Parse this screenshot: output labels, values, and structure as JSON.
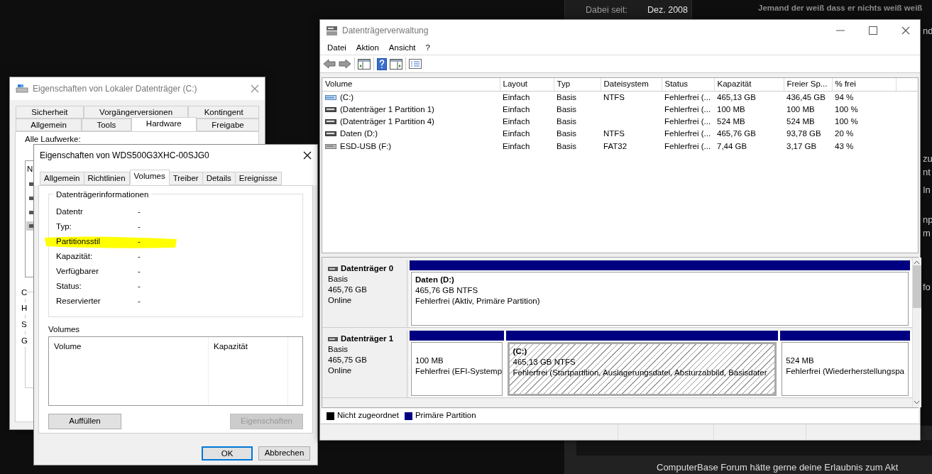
{
  "forum_background": {
    "member_since_label": "Dabei seit:",
    "member_since_value": "Dez. 2008",
    "signature": "Jemand der weiß dass er nichts weiß weiß",
    "side_fragments": [
      "nd",
      "zu",
      "nt",
      "In",
      "np",
      "m",
      "fo"
    ],
    "consent_banner": "ComputerBase Forum hätte gerne deine Erlaubnis zum Akt"
  },
  "disk_management": {
    "title": "Datenträgerverwaltung",
    "menu": [
      "Datei",
      "Aktion",
      "Ansicht",
      "?"
    ],
    "table": {
      "columns": [
        "Volume",
        "Layout",
        "Typ",
        "Dateisystem",
        "Status",
        "Kapazität",
        "Freier Sp...",
        "% frei"
      ],
      "rows": [
        {
          "kind": "system",
          "cells": [
            "(C:)",
            "Einfach",
            "Basis",
            "NTFS",
            "Fehlerfrei (...",
            "465,13 GB",
            "436,45 GB",
            "94 %"
          ]
        },
        {
          "kind": "partition",
          "cells": [
            "(Datenträger 1 Partition 1)",
            "Einfach",
            "Basis",
            "",
            "Fehlerfrei (...",
            "100 MB",
            "100 MB",
            "100 %"
          ]
        },
        {
          "kind": "partition",
          "cells": [
            "(Datenträger 1 Partition 4)",
            "Einfach",
            "Basis",
            "",
            "Fehlerfrei (...",
            "524 MB",
            "524 MB",
            "100 %"
          ]
        },
        {
          "kind": "partition",
          "cells": [
            "Daten (D:)",
            "Einfach",
            "Basis",
            "NTFS",
            "Fehlerfrei (...",
            "465,76 GB",
            "93,78 GB",
            "20 %"
          ]
        },
        {
          "kind": "usb",
          "cells": [
            "ESD-USB (F:)",
            "Einfach",
            "Basis",
            "FAT32",
            "Fehlerfrei (...",
            "7,44 GB",
            "3,17 GB",
            "43 %"
          ]
        }
      ]
    },
    "disks": [
      {
        "name": "Datenträger 0",
        "type": "Basis",
        "size": "465,76 GB",
        "status": "Online",
        "partitions": [
          {
            "title": "Daten  (D:)",
            "size": "465,76 GB NTFS",
            "status": "Fehlerfrei (Aktiv, Primäre Partition)",
            "selected": false
          }
        ]
      },
      {
        "name": "Datenträger 1",
        "type": "Basis",
        "size": "465,75 GB",
        "status": "Online",
        "partitions": [
          {
            "size": "100 MB",
            "status": "Fehlerfrei (EFI-Systemp",
            "selected": false
          },
          {
            "title": "(C:)",
            "size": "465,13 GB NTFS",
            "status": "Fehlerfrei (Startpartition, Auslagerungsdatei, Absturzabbild, Basisdater",
            "selected": true
          },
          {
            "size": "524 MB",
            "status": "Fehlerfrei (Wiederherstellungspa",
            "selected": false
          }
        ]
      }
    ],
    "legend": [
      {
        "label": "Nicht zugeordnet",
        "color": "#000000"
      },
      {
        "label": "Primäre Partition",
        "color": "#000080"
      }
    ]
  },
  "drive_properties": {
    "title": "Eigenschaften von Lokaler Datenträger (C:)",
    "tab_rows": [
      [
        {
          "label": "Sicherheit",
          "selected": false
        },
        {
          "label": "Vorgängerversionen",
          "selected": false
        },
        {
          "label": "Kontingent",
          "selected": false
        }
      ],
      [
        {
          "label": "Allgemein",
          "selected": false
        },
        {
          "label": "Tools",
          "selected": false
        },
        {
          "label": "Hardware",
          "selected": true
        },
        {
          "label": "Freigabe",
          "selected": false
        }
      ]
    ],
    "list_label": "Alle Laufwerke:",
    "list_fragment": "N",
    "group_fragments": [
      "C",
      "H",
      "S",
      "G"
    ]
  },
  "device_properties": {
    "title": "Eigenschaften von WDS500G3XHC-00SJG0",
    "tabs": [
      {
        "label": "Allgemein",
        "selected": false
      },
      {
        "label": "Richtlinien",
        "selected": false
      },
      {
        "label": "Volumes",
        "selected": true
      },
      {
        "label": "Treiber",
        "selected": false
      },
      {
        "label": "Details",
        "selected": false
      },
      {
        "label": "Ereignisse",
        "selected": false
      }
    ],
    "group_title": "Datenträgerinformationen",
    "fields": [
      {
        "label": "Datentr",
        "value": "-",
        "highlighted": false
      },
      {
        "label": "Typ:",
        "value": "-",
        "highlighted": false
      },
      {
        "label": "Partitionsstil",
        "value": "-",
        "highlighted": true
      },
      {
        "label": "Kapazität:",
        "value": "-",
        "highlighted": false
      },
      {
        "label": "Verfügbarer",
        "value": "-",
        "highlighted": false
      },
      {
        "label": "Status:",
        "value": "-",
        "highlighted": false
      },
      {
        "label": "Reservierter",
        "value": "-",
        "highlighted": false
      }
    ],
    "volumes_label": "Volumes",
    "volume_columns": [
      "Volume",
      "Kapazität"
    ],
    "buttons": [
      {
        "label": "Auffüllen",
        "disabled": false
      },
      {
        "label": "Eigenschaften",
        "disabled": true
      }
    ],
    "footer_buttons": [
      {
        "label": "OK",
        "focused": true
      },
      {
        "label": "Abbrechen",
        "focused": false
      }
    ]
  }
}
